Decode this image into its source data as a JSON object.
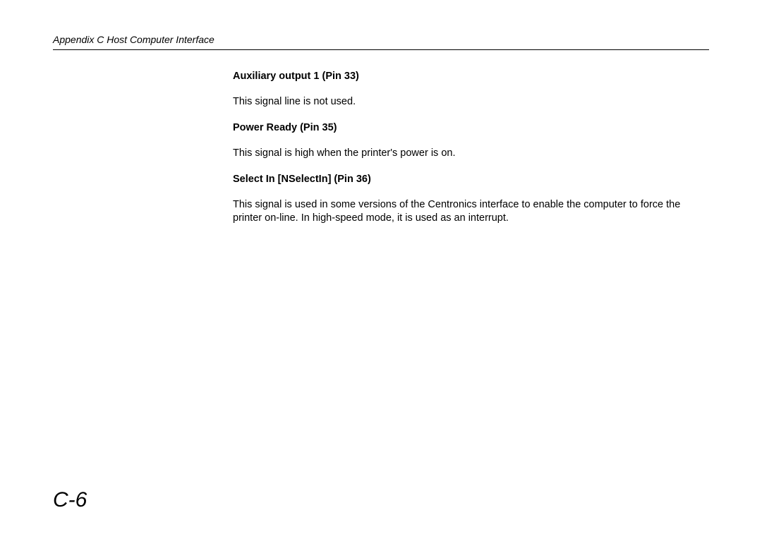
{
  "header": {
    "title": "Appendix C  Host Computer Interface"
  },
  "sections": [
    {
      "heading": "Auxiliary output 1 (Pin 33)",
      "body": "This signal line is not used."
    },
    {
      "heading": "Power Ready (Pin 35)",
      "body": "This signal is high when the printer's power is on."
    },
    {
      "heading": "Select In [NSelectIn] (Pin 36)",
      "body": "This signal is used in some versions of the Centronics interface to enable the computer to force the printer on-line. In high-speed mode, it is used as an interrupt."
    }
  ],
  "page_number": "C-6"
}
